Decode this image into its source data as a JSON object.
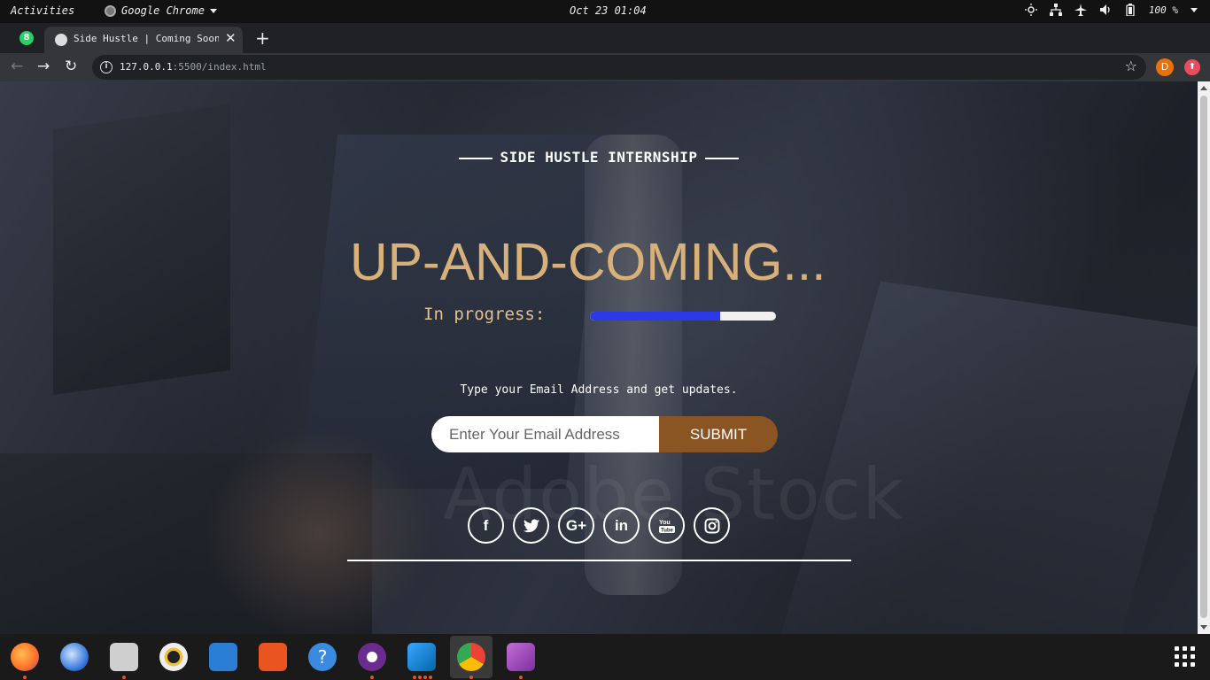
{
  "topbar": {
    "activities": "Activities",
    "app_name": "Google Chrome",
    "clock": "Oct 23  01:04",
    "battery": "100 %"
  },
  "browser": {
    "tabs": [
      {
        "badge": "8",
        "icon": "whatsapp-icon"
      },
      {
        "title": "Side Hustle | Coming Soon",
        "icon": "globe-icon"
      }
    ],
    "url_host": "127.0.0.1",
    "url_rest": ":5500/index.html",
    "profile_initial": "D"
  },
  "page": {
    "kicker": "SIDE HUSTLE INTERNSHIP",
    "headline": "UP-AND-COMING...",
    "progress_label": "In progress:",
    "progress_value": 0.7,
    "prompt": "Type your Email Address and get updates.",
    "email_placeholder": "Enter Your Email Address",
    "submit_label": "SUBMIT",
    "watermark": "Adobe Stock",
    "socials": [
      {
        "icon": "facebook-icon",
        "glyph": "f"
      },
      {
        "icon": "twitter-icon",
        "glyph": "🐦"
      },
      {
        "icon": "google-plus-icon",
        "glyph": "G+"
      },
      {
        "icon": "linkedin-icon",
        "glyph": "in"
      },
      {
        "icon": "youtube-icon",
        "glyph": "▶"
      },
      {
        "icon": "instagram-icon",
        "glyph": "◎"
      }
    ],
    "colors": {
      "headline": "#d8b07a",
      "progress_fill": "#2b3ae6",
      "submit_bg": "#8a5423"
    }
  },
  "dock": {
    "apps": [
      "firefox-icon",
      "thunderbird-icon",
      "files-icon",
      "rhythmbox-icon",
      "writer-icon",
      "software-icon",
      "help-icon",
      "media-player-icon",
      "vscode-icon",
      "chrome-icon",
      "video-icon"
    ]
  }
}
